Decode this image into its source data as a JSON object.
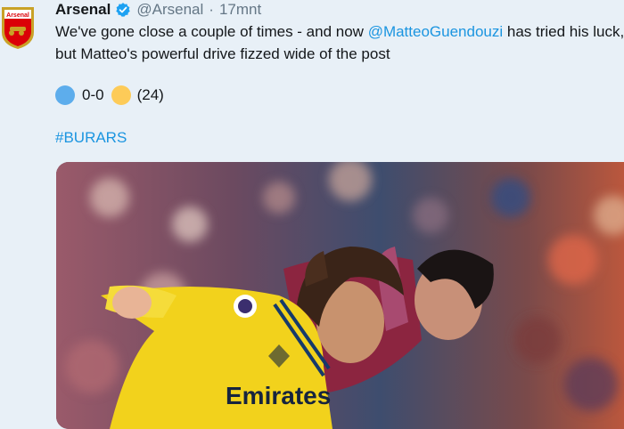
{
  "tweet": {
    "author_name": "Arsenal",
    "handle": "@Arsenal",
    "separator": "·",
    "time": "17mnt",
    "text_before": "We've gone close a couple of times - and now ",
    "mention": "@MatteoGuendouzi",
    "text_after": " has tried his luck, but Matteo's powerful drive fizzed wide of the post",
    "score": "0-0",
    "minute": "(24)",
    "hashtag": "#BURARS"
  },
  "avatar": {
    "label": "Arsenal",
    "colors": {
      "red": "#db0007",
      "gold": "#c9a227"
    }
  },
  "icons": {
    "verified": "verified-badge-icon",
    "home_team": "blue-circle-emoji",
    "away_team": "yellow-circle-emoji"
  },
  "colors": {
    "link": "#1b95e0",
    "muted": "#657786",
    "background": "#e8f0f7"
  },
  "media": {
    "shirt_text": "Emirates"
  }
}
